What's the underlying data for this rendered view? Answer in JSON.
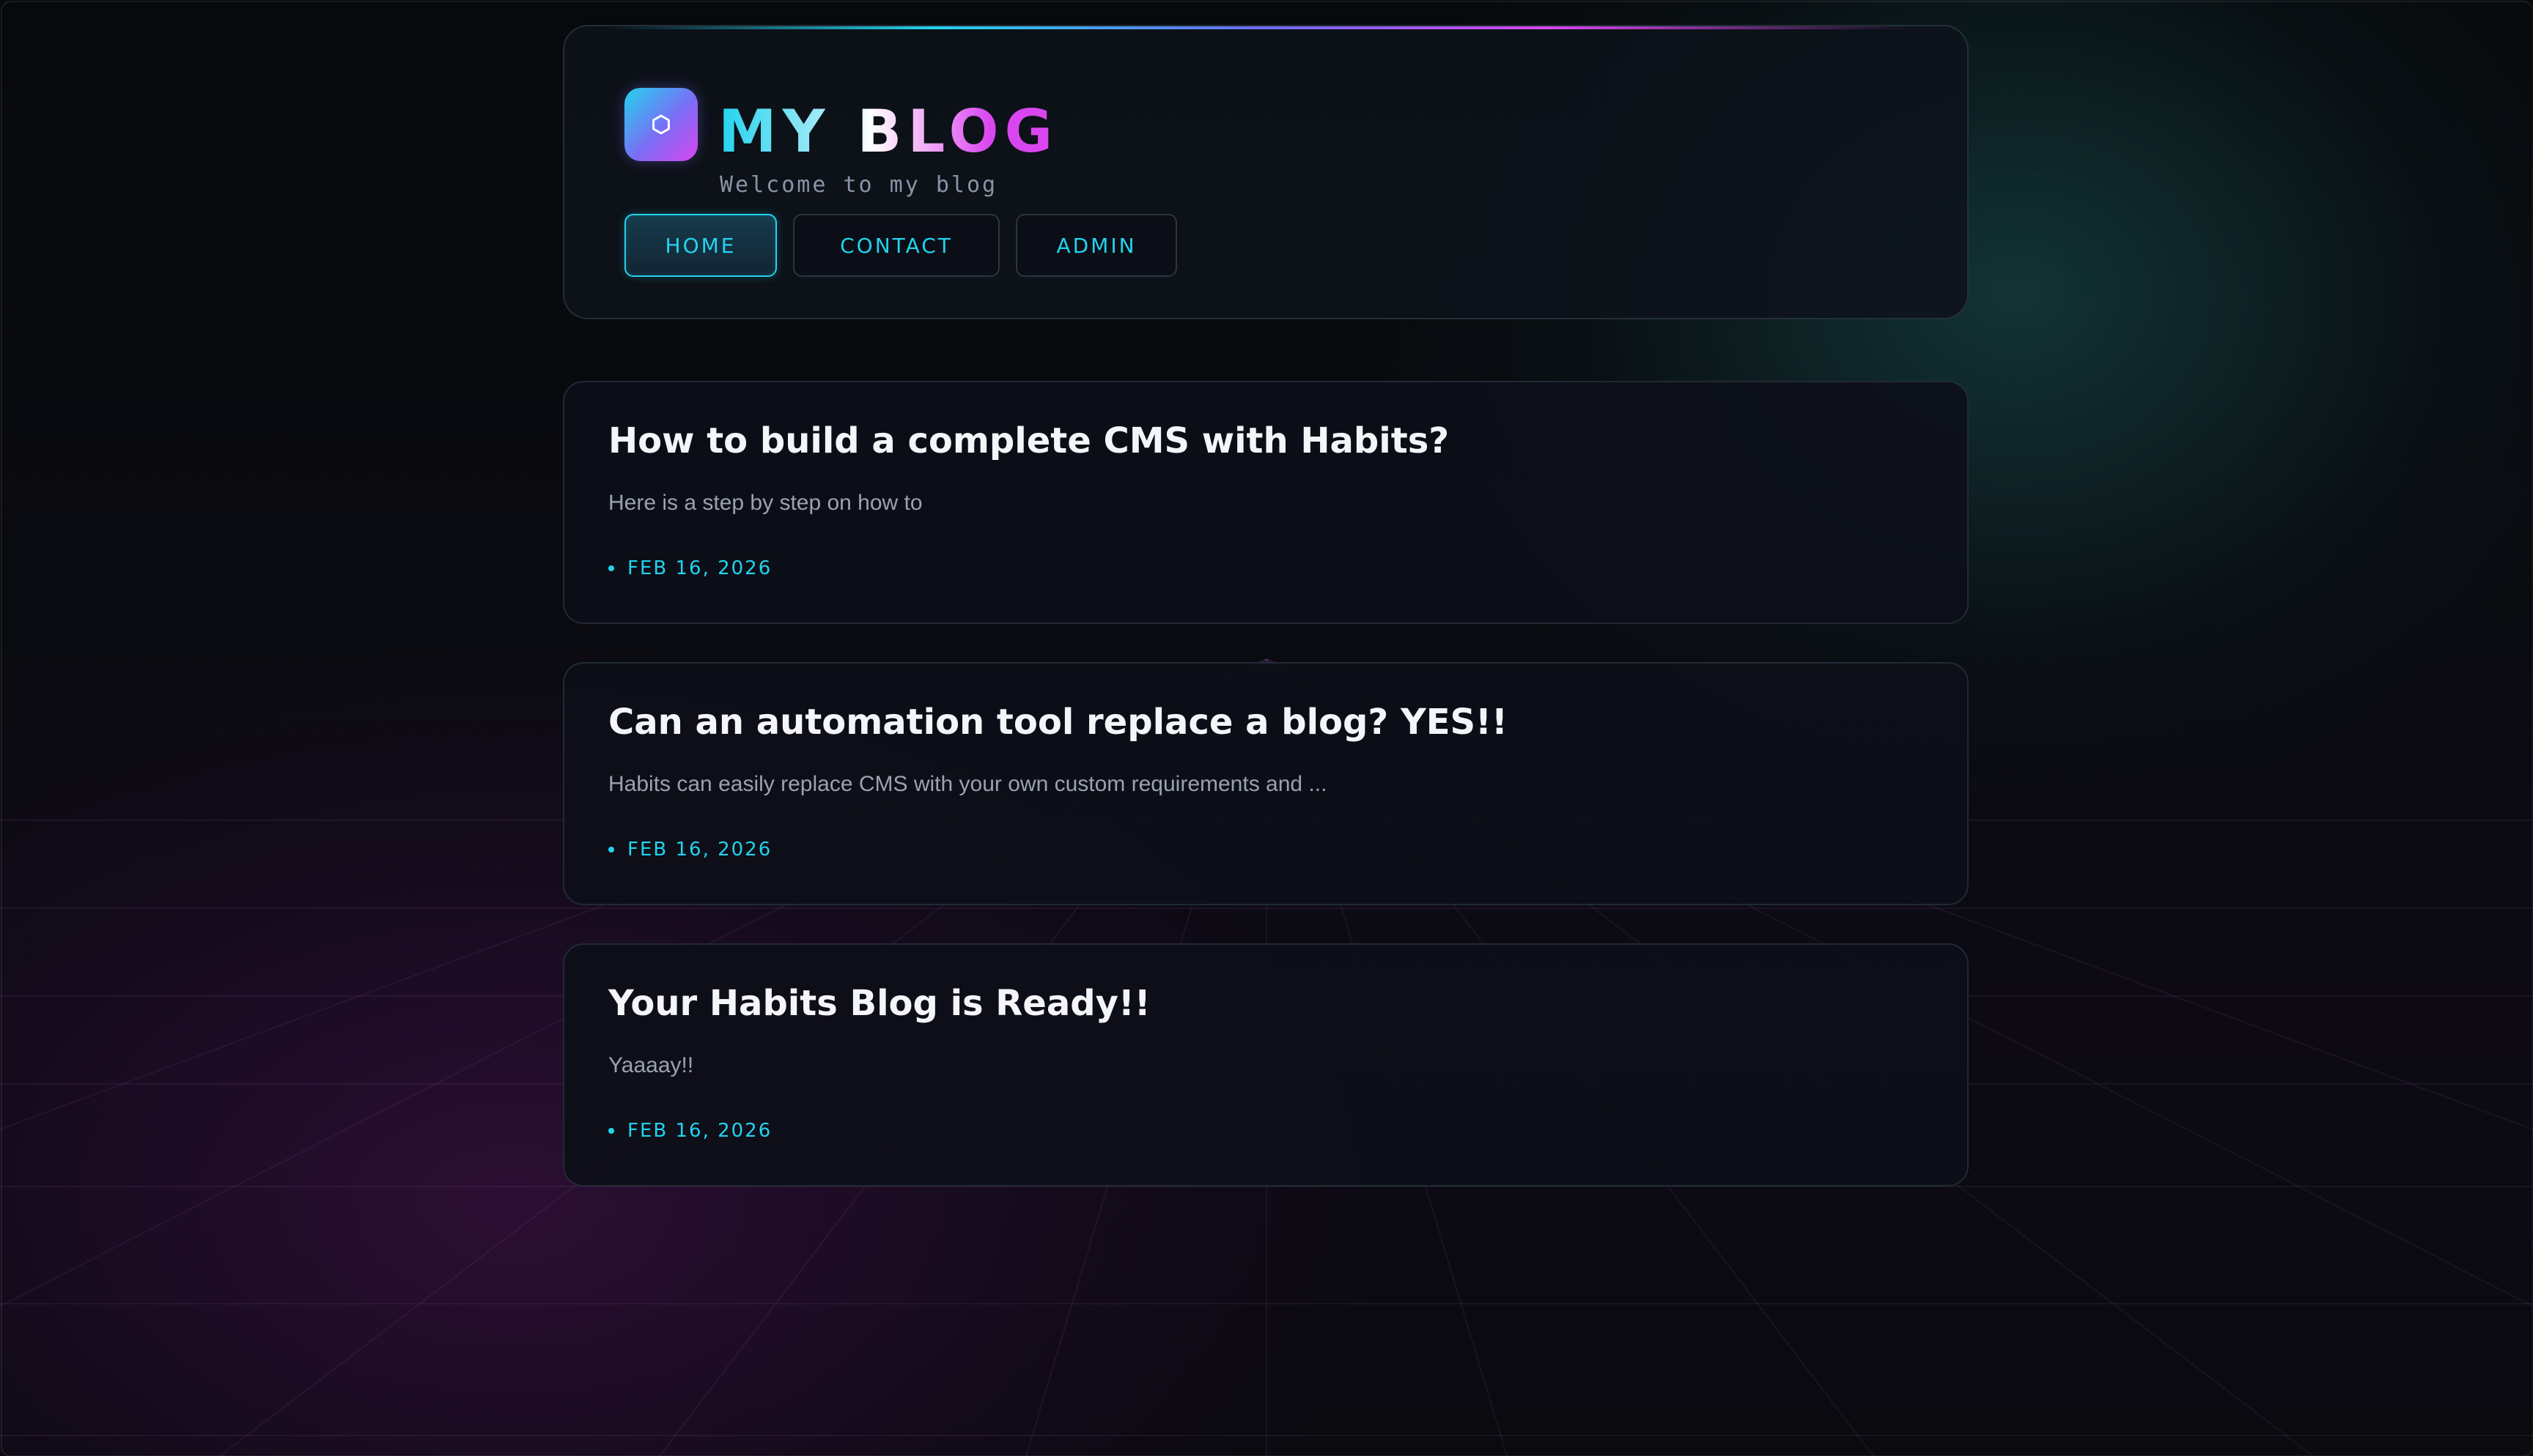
{
  "colors": {
    "accent_cyan": "#22d3ee",
    "accent_magenta": "#d946ef",
    "accent_violet": "#7c6cf5",
    "background": "#07080b",
    "card": "#0d0f18",
    "title_text": "#f4f5f8",
    "muted_text": "#9aa2b1"
  },
  "header": {
    "logo_icon": "hexagon-icon",
    "title": "MY BLOG",
    "subtitle": "Welcome to my blog"
  },
  "nav": {
    "items": [
      {
        "label": "HOME",
        "active": true
      },
      {
        "label": "CONTACT",
        "active": false
      },
      {
        "label": "ADMIN",
        "active": false
      }
    ]
  },
  "posts": [
    {
      "title": "How to build a complete CMS with Habits?",
      "excerpt": "Here is a step by step on how to",
      "date": "FEB 16, 2026"
    },
    {
      "title": "Can an automation tool replace a blog? YES!!",
      "excerpt": "Habits can easily replace CMS with your own custom requirements and ...",
      "date": "FEB 16, 2026"
    },
    {
      "title": "Your Habits Blog is Ready!!",
      "excerpt": "Yaaaay!!",
      "date": "FEB 16, 2026"
    }
  ]
}
